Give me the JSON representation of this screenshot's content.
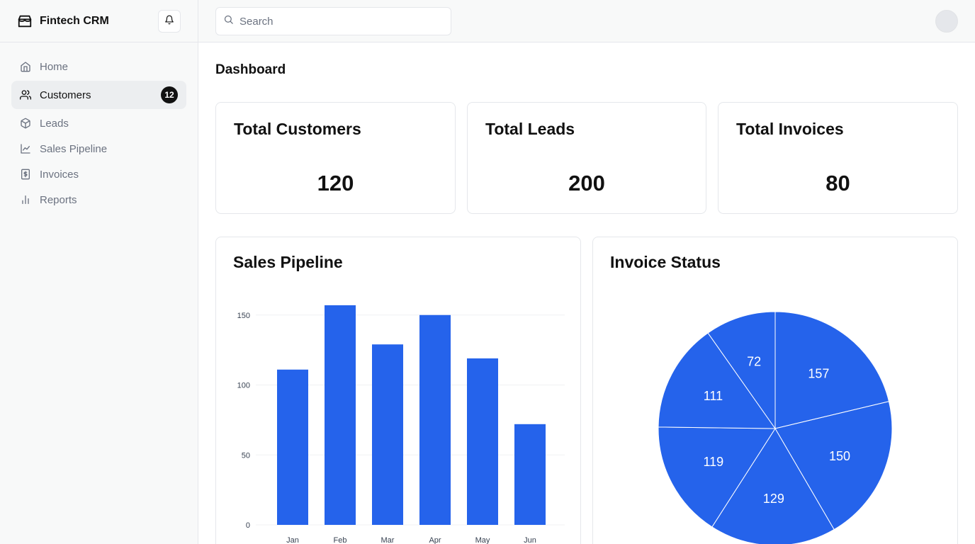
{
  "app": {
    "name": "Fintech CRM"
  },
  "search": {
    "placeholder": "Search"
  },
  "sidebar": {
    "items": [
      {
        "label": "Home",
        "icon": "home-icon"
      },
      {
        "label": "Customers",
        "icon": "users-icon",
        "badge": "12",
        "active": true
      },
      {
        "label": "Leads",
        "icon": "package-icon"
      },
      {
        "label": "Sales Pipeline",
        "icon": "line-chart-icon"
      },
      {
        "label": "Invoices",
        "icon": "invoice-icon"
      },
      {
        "label": "Reports",
        "icon": "bar-chart-icon"
      }
    ]
  },
  "page": {
    "title": "Dashboard"
  },
  "stats": [
    {
      "title": "Total Customers",
      "value": "120"
    },
    {
      "title": "Total Leads",
      "value": "200"
    },
    {
      "title": "Total Invoices",
      "value": "80"
    }
  ],
  "colors": {
    "accent": "#2563eb",
    "badge": "#111111"
  },
  "chart_data": [
    {
      "type": "bar",
      "title": "Sales Pipeline",
      "categories": [
        "Jan",
        "Feb",
        "Mar",
        "Apr",
        "May",
        "Jun"
      ],
      "values": [
        111,
        157,
        129,
        150,
        119,
        72
      ],
      "ylim": [
        0,
        160
      ],
      "yticks": [
        0,
        50,
        100,
        150
      ],
      "grid": true
    },
    {
      "type": "pie",
      "title": "Invoice Status",
      "values": [
        157,
        150,
        129,
        119,
        111,
        72
      ]
    }
  ]
}
